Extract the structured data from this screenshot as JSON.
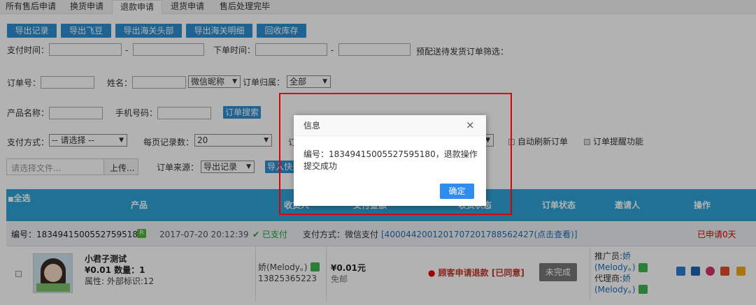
{
  "tabs": [
    {
      "label": "所有售后申请"
    },
    {
      "label": "换货申请"
    },
    {
      "label": "退款申请"
    },
    {
      "label": "退货申请"
    },
    {
      "label": "售后处理完毕"
    }
  ],
  "toolbar": {
    "export_record": "导出记录",
    "export_feidou": "导出飞豆",
    "export_customs_head": "导出海关头部",
    "export_customs_detail": "导出海关明细",
    "recycle_stock": "回收库存"
  },
  "filters": {
    "pay_time_label": "支付时间：",
    "dash": "-",
    "order_time_label": "下单时间：",
    "presale_label": "预配送待发货订单筛选：",
    "order_no_label": "订单号：",
    "name_label": "姓名：",
    "nickname_select": "微信昵称",
    "order_owner_label": "订单归属：",
    "order_owner_select": "全部",
    "product_name_label": "产品名称：",
    "phone_label": "手机号码：",
    "search_button": "订单搜索",
    "pay_method_label": "支付方式：",
    "pay_method_select": "-- 请选择 --",
    "per_page_label": "每页记录数：",
    "per_page_select": "20",
    "auto_refresh_label": "自动刷新订单",
    "order_remind_label": "订单提醒功能",
    "file_placeholder": "请选择文件...",
    "upload_button": "上传...",
    "order_source_label": "订单来源：",
    "order_source_select": "导出记录",
    "import_button": "导入快递"
  },
  "table": {
    "headers": [
      "全选",
      "产品",
      "收货人",
      "支付金额",
      "收货状态",
      "订单状态",
      "邀请人",
      "操作"
    ],
    "order_header": {
      "order_no_text": "编号：1834941500552759518",
      "order_no_last": "0",
      "time": "2017-07-20 20:12:39",
      "paid_status": "已支付",
      "pay_method": "支付方式：微信支付",
      "txn_link": "[4000442001201707201788562427(点击查看)]",
      "applied": "已申请0天"
    },
    "row": {
      "product_name": "小君子测试",
      "price_qty": "¥0.01 数量：1",
      "attrs": "属性: 外部标识:12",
      "consignee_name": "娇(Melody。)",
      "consignee_phone": "13825365223",
      "amount": "¥0.01元",
      "shipping": "免邮",
      "refund_status": "顾客申请退款 [已同意]",
      "order_status": "未完成",
      "promoter_label": "推广员:",
      "promoter_name_1": "娇",
      "promoter_name_2": "(Melody。)",
      "agent_label": "代理商:",
      "agent_name_1": "娇",
      "agent_name_2": "(Melody。)"
    }
  },
  "dialog": {
    "title": "信息",
    "close": "×",
    "message_line1": "编号：1834941500552759518",
    "message_line1b": "0，退款操作",
    "message_line2": "提交成功",
    "ok": "确定"
  },
  "colors": {
    "accent": "#2b8fd0",
    "header_bg": "#2ea3d7",
    "red": "#e00000",
    "green": "#22a040"
  }
}
